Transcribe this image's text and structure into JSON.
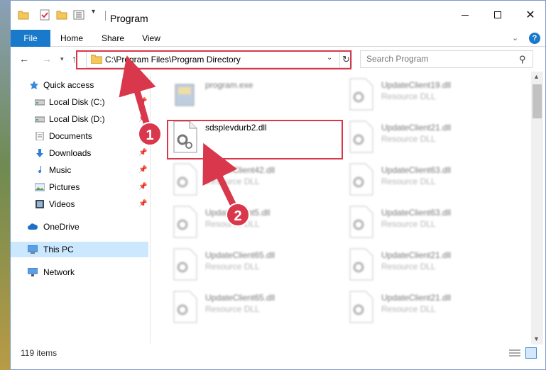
{
  "window": {
    "title": "Program",
    "accent_color": "#1979ca",
    "highlight_color": "#d9374b"
  },
  "ribbon": {
    "tabs": [
      "File",
      "Home",
      "Share",
      "View"
    ]
  },
  "address": {
    "path": "C:\\Program Files\\Program Directory",
    "search_placeholder": "Search Program"
  },
  "sidebar": {
    "items": [
      {
        "label": "Quick access",
        "icon": "star-icon",
        "pinned": false
      },
      {
        "label": "Local Disk (C:)",
        "icon": "drive-icon",
        "pinned": true
      },
      {
        "label": "Local Disk (D:)",
        "icon": "drive-icon",
        "pinned": true
      },
      {
        "label": "Documents",
        "icon": "documents-icon",
        "pinned": true
      },
      {
        "label": "Downloads",
        "icon": "download-icon",
        "pinned": true
      },
      {
        "label": "Music",
        "icon": "music-icon",
        "pinned": true
      },
      {
        "label": "Pictures",
        "icon": "pictures-icon",
        "pinned": true
      },
      {
        "label": "Videos",
        "icon": "videos-icon",
        "pinned": true
      },
      {
        "label": "OneDrive",
        "icon": "cloud-icon",
        "pinned": false
      },
      {
        "label": "This PC",
        "icon": "computer-icon",
        "pinned": false,
        "selected": true
      },
      {
        "label": "Network",
        "icon": "network-icon",
        "pinned": false
      }
    ]
  },
  "files": {
    "left_column": [
      {
        "name": "program.exe",
        "desc": "",
        "blurred": true
      },
      {
        "name": "sdsplevdurb2.dll",
        "desc": "",
        "blurred": false,
        "highlighted": true
      },
      {
        "name": "UpdateClient42.dll",
        "desc": "Resource DLL",
        "blurred": true
      },
      {
        "name": "UpdateClient5.dll",
        "desc": "Resource DLL",
        "blurred": true
      },
      {
        "name": "UpdateClient65.dll",
        "desc": "Resource DLL",
        "blurred": true
      },
      {
        "name": "UpdateClient65.dll",
        "desc": "Resource DLL",
        "blurred": true
      }
    ],
    "right_column": [
      {
        "name": "UpdateClient19.dll",
        "desc": "Resource DLL",
        "blurred": true
      },
      {
        "name": "UpdateClient21.dll",
        "desc": "Resource DLL",
        "blurred": true
      },
      {
        "name": "UpdateClient63.dll",
        "desc": "Resource DLL",
        "blurred": true
      },
      {
        "name": "UpdateClient63.dll",
        "desc": "Resource DLL",
        "blurred": true
      },
      {
        "name": "UpdateClient21.dll",
        "desc": "Resource DLL",
        "blurred": true
      },
      {
        "name": "UpdateClient21.dll",
        "desc": "Resource DLL",
        "blurred": true
      }
    ]
  },
  "status": {
    "item_count": "119 items"
  },
  "annotations": {
    "step1": "1",
    "step2": "2"
  }
}
